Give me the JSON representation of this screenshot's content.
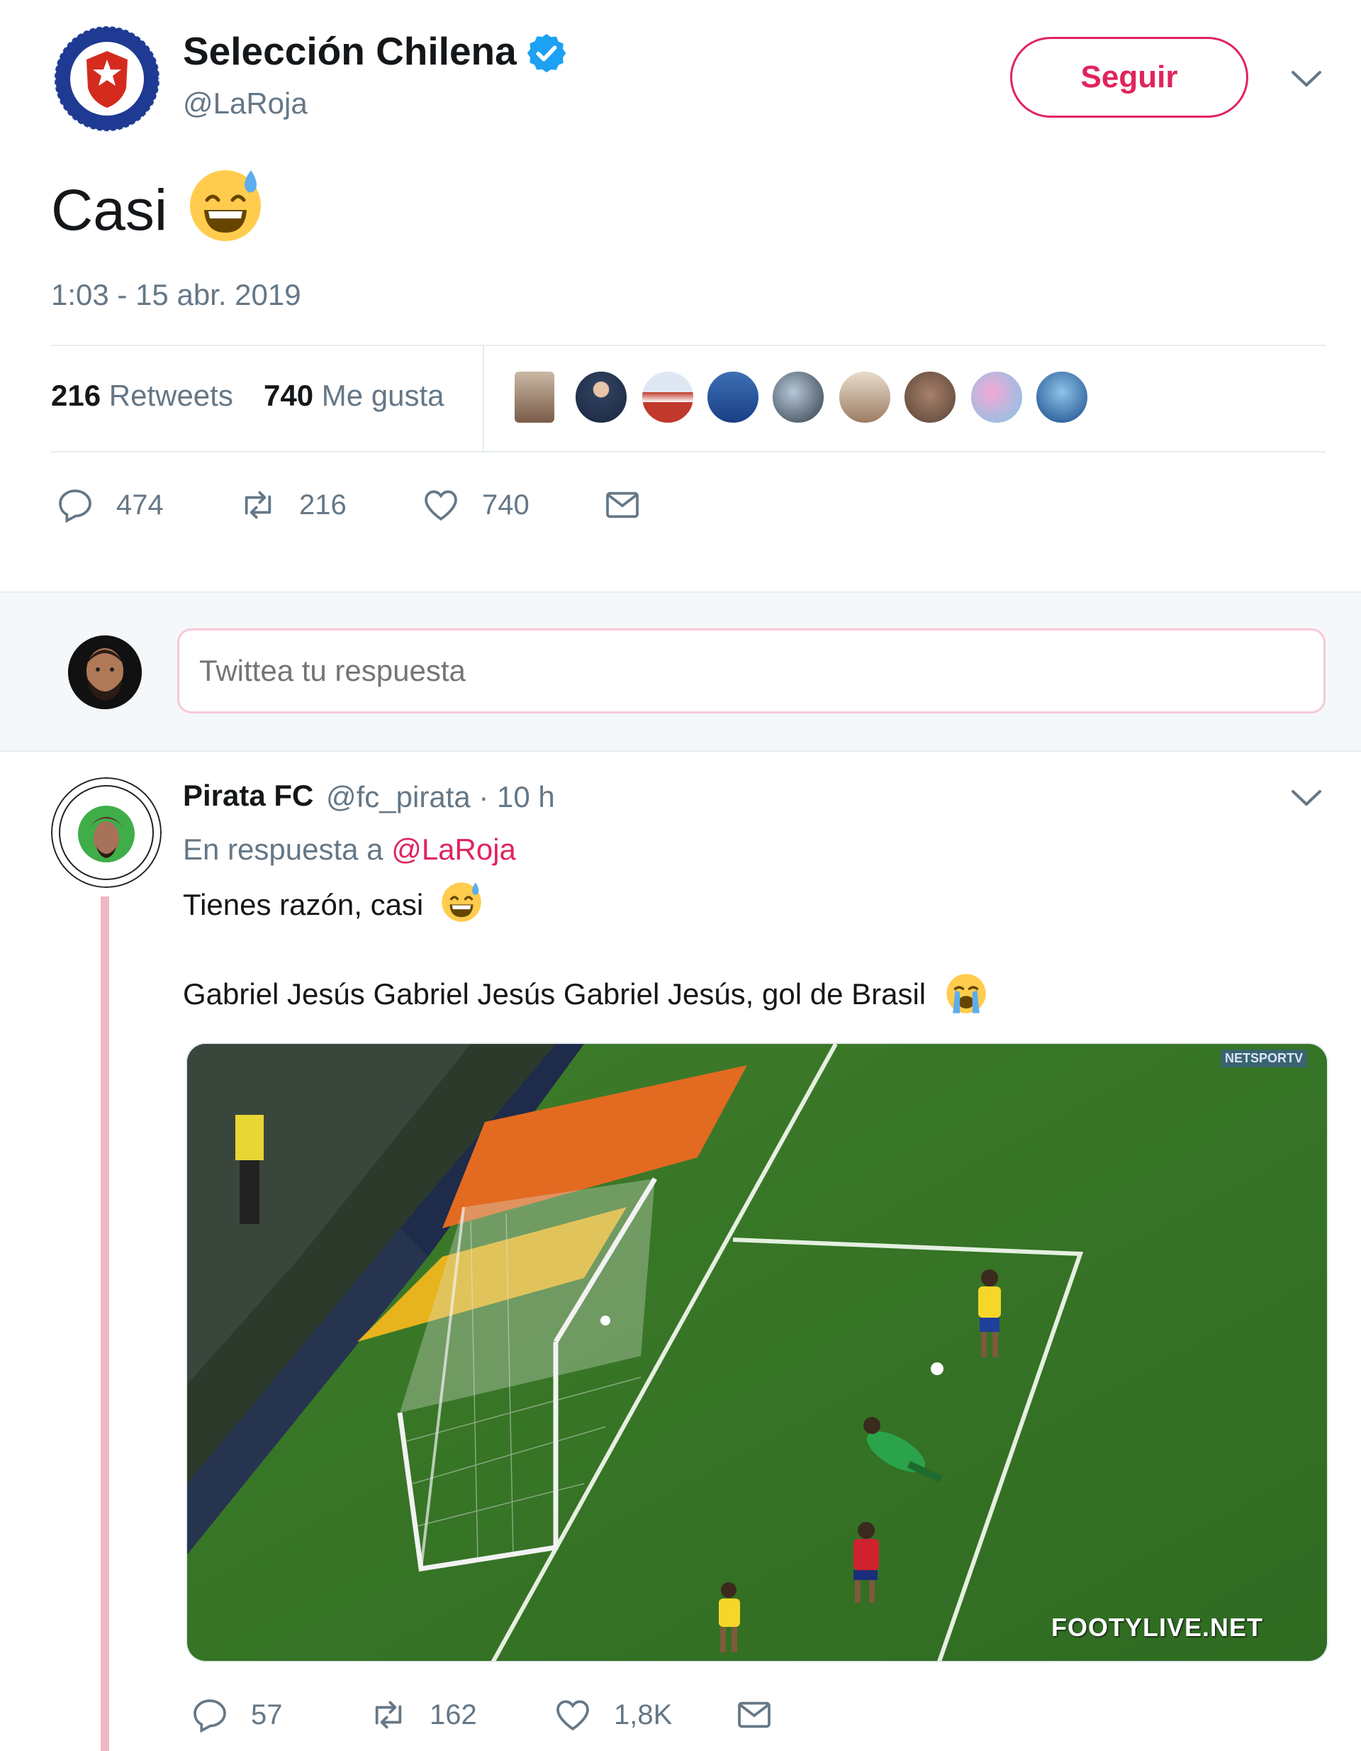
{
  "tweet": {
    "display_name": "Selección Chilena",
    "handle": "@LaRoja",
    "follow_label": "Seguir",
    "text": "Casi",
    "timestamp": "1:03 - 15 abr. 2019",
    "retweets_count": "216",
    "retweets_label": "Retweets",
    "likes_count": "740",
    "likes_label": "Me gusta",
    "actions": {
      "replies": "474",
      "retweets": "216",
      "likes": "740"
    }
  },
  "reply_box": {
    "placeholder": "Twittea tu respuesta"
  },
  "reply": {
    "display_name": "Pirata FC",
    "meta": "@fc_pirata · 10 h",
    "in_reply_prefix": "En respuesta a",
    "in_reply_handle": "@LaRoja",
    "line1": "Tienes razón, casi",
    "line2": "Gabriel Jesús Gabriel Jesús Gabriel Jesús, gol de Brasil",
    "video_watermark": "FOOTYLIVE.NET",
    "video_channel_logo": "NETSPORTV",
    "actions": {
      "replies": "57",
      "retweets": "162",
      "likes": "1,8K"
    }
  },
  "colors": {
    "accent": "#e0245e",
    "text": "#14171a",
    "muted": "#657786",
    "verified": "#1da1f2",
    "divider": "#e6ecf0"
  }
}
